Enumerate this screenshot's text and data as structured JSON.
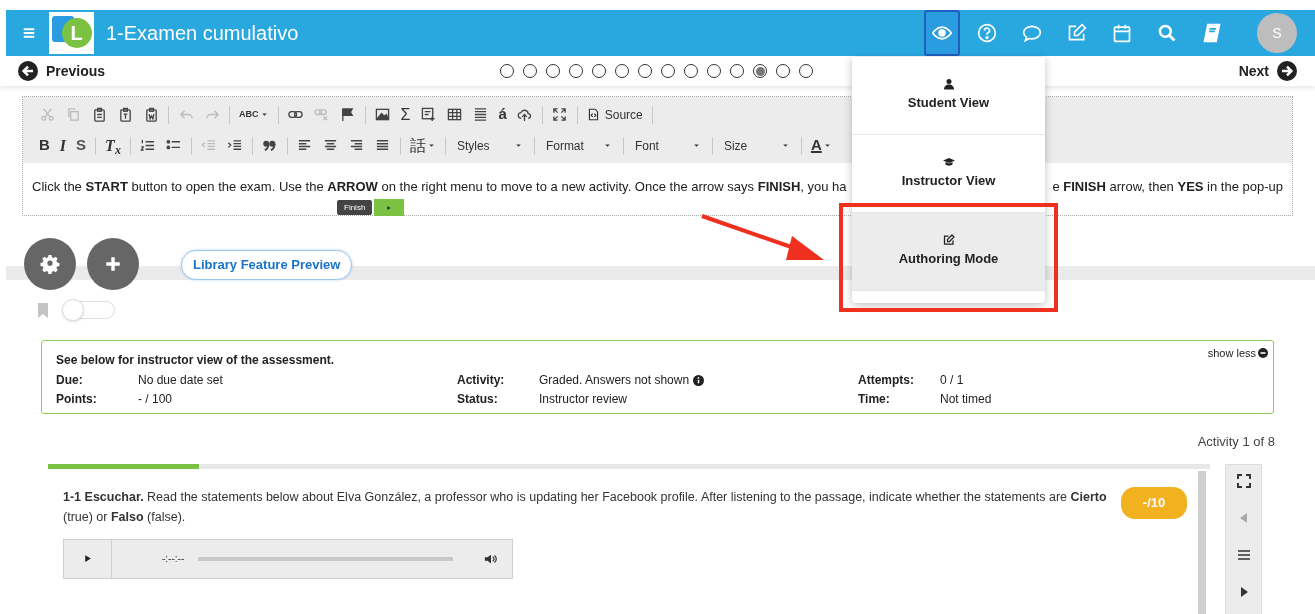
{
  "header": {
    "title": "1-Examen cumulativo",
    "logo_letter": "L",
    "avatar": "S",
    "icons": [
      {
        "selected": true
      },
      {
        "selected": false
      },
      {
        "selected": false
      },
      {
        "selected": false
      },
      {
        "selected": false
      },
      {
        "selected": false
      },
      {
        "selected": false
      }
    ]
  },
  "nav": {
    "previous": "Previous",
    "next": "Next",
    "pages": [
      {
        "selected": false
      },
      {
        "selected": false
      },
      {
        "selected": false
      },
      {
        "selected": false
      },
      {
        "selected": false
      },
      {
        "selected": false
      },
      {
        "selected": false
      },
      {
        "selected": false
      },
      {
        "selected": false
      },
      {
        "selected": false
      },
      {
        "selected": false
      },
      {
        "selected": true
      },
      {
        "selected": false
      },
      {
        "selected": false
      }
    ]
  },
  "editor": {
    "toolbar_rows": [
      [
        {
          "kind": "icon",
          "disabled": true
        },
        {
          "kind": "icon",
          "disabled": true
        },
        {
          "kind": "icon",
          "disabled": false
        },
        {
          "kind": "icon",
          "disabled": false
        },
        {
          "kind": "icon",
          "disabled": false
        },
        {
          "kind": "sep"
        },
        {
          "kind": "icon",
          "disabled": true
        },
        {
          "kind": "icon",
          "disabled": true
        },
        {
          "kind": "sep"
        },
        {
          "kind": "text",
          "label": "ABC",
          "caret": true
        },
        {
          "kind": "sep"
        },
        {
          "kind": "icon",
          "disabled": false
        },
        {
          "kind": "icon",
          "disabled": true
        },
        {
          "kind": "icon",
          "disabled": false
        },
        {
          "kind": "sep"
        },
        {
          "kind": "icon",
          "disabled": false
        },
        {
          "kind": "text",
          "label": "Σ",
          "caret": false
        },
        {
          "kind": "icon",
          "disabled": false
        },
        {
          "kind": "icon",
          "disabled": false
        },
        {
          "kind": "icon",
          "disabled": false
        },
        {
          "kind": "text",
          "label": "á",
          "caret": false
        },
        {
          "kind": "icon",
          "disabled": false
        },
        {
          "kind": "sep"
        },
        {
          "kind": "icon",
          "disabled": false
        },
        {
          "kind": "sep"
        },
        {
          "kind": "button",
          "label": "Source"
        },
        {
          "kind": "sep"
        }
      ],
      [
        {
          "kind": "text",
          "label": "B",
          "caret": false
        },
        {
          "kind": "text",
          "label": "I",
          "caret": false
        },
        {
          "kind": "text",
          "label": "S",
          "caret": false
        },
        {
          "kind": "sep"
        },
        {
          "kind": "text",
          "label": "T$_{x}$",
          "caret": false
        },
        {
          "kind": "sep"
        },
        {
          "kind": "icon",
          "disabled": false
        },
        {
          "kind": "icon",
          "disabled": false
        },
        {
          "kind": "sep"
        },
        {
          "kind": "icon",
          "disabled": true
        },
        {
          "kind": "icon",
          "disabled": false
        },
        {
          "kind": "sep"
        },
        {
          "kind": "icon",
          "disabled": false
        },
        {
          "kind": "sep"
        },
        {
          "kind": "icon",
          "disabled": false
        },
        {
          "kind": "icon",
          "disabled": false
        },
        {
          "kind": "icon",
          "disabled": false
        },
        {
          "kind": "icon",
          "disabled": false
        },
        {
          "kind": "sep"
        },
        {
          "kind": "text",
          "label": "話",
          "caret": true
        },
        {
          "kind": "sep"
        },
        {
          "kind": "combo",
          "label": "Styles"
        },
        {
          "kind": "sep"
        },
        {
          "kind": "combo",
          "label": "Format"
        },
        {
          "kind": "sep"
        },
        {
          "kind": "combo",
          "label": "Font"
        },
        {
          "kind": "sep"
        },
        {
          "kind": "combo",
          "label": "Size"
        },
        {
          "kind": "sep"
        },
        {
          "kind": "text",
          "label": "A",
          "caret": true
        }
      ]
    ],
    "text_left": "Click the **START** button to open the exam. Use the **ARROW** on the right menu to move to a new activity. Once the arrow says **FINISH**, you ha",
    "text_right": "e **FINISH** arrow, then **YES** in the pop-up",
    "finish_tip": {
      "label": "Finish",
      "arrow": "▸"
    }
  },
  "view_menu": {
    "items": [
      {
        "label": "Student View",
        "selected": false
      },
      {
        "label": "Instructor View",
        "selected": false
      },
      {
        "label": "Authoring Mode",
        "selected": true
      }
    ]
  },
  "actions": {
    "library_button": "Library Feature Preview",
    "bookmark_toggle": {
      "on": false
    }
  },
  "info": {
    "heading": "See below for instructor view of the assessment.",
    "show_less": "show less",
    "fields": [
      {
        "label": "Due:",
        "value": "No due date set",
        "info": false
      },
      {
        "label": "Activity:",
        "value": "Graded. Answers not shown",
        "info": true
      },
      {
        "label": "Attempts:",
        "value": "0 / 1",
        "info": false
      },
      {
        "label": "Points:",
        "value": "- / 100",
        "info": false
      },
      {
        "label": "Status:",
        "value": "Instructor review",
        "info": false
      },
      {
        "label": "Time:",
        "value": "Not timed",
        "info": false
      }
    ]
  },
  "activity_counter": "Activity 1 of 8",
  "activity": {
    "progress": {
      "level": 0.13
    },
    "prompt": "**1-1 Escuchar.** Read the statements below about Elva González, a professor who is updating her Facebook profile. After listening to the passage, indicate whether the statements are **Cierto** (true) or **Falso** (false).",
    "score": "-/10",
    "audio": {
      "time": "-:--:--"
    },
    "side_tools": [
      {
        "disabled": false
      },
      {
        "disabled": true
      },
      {
        "disabled": false
      },
      {
        "disabled": false
      }
    ]
  }
}
